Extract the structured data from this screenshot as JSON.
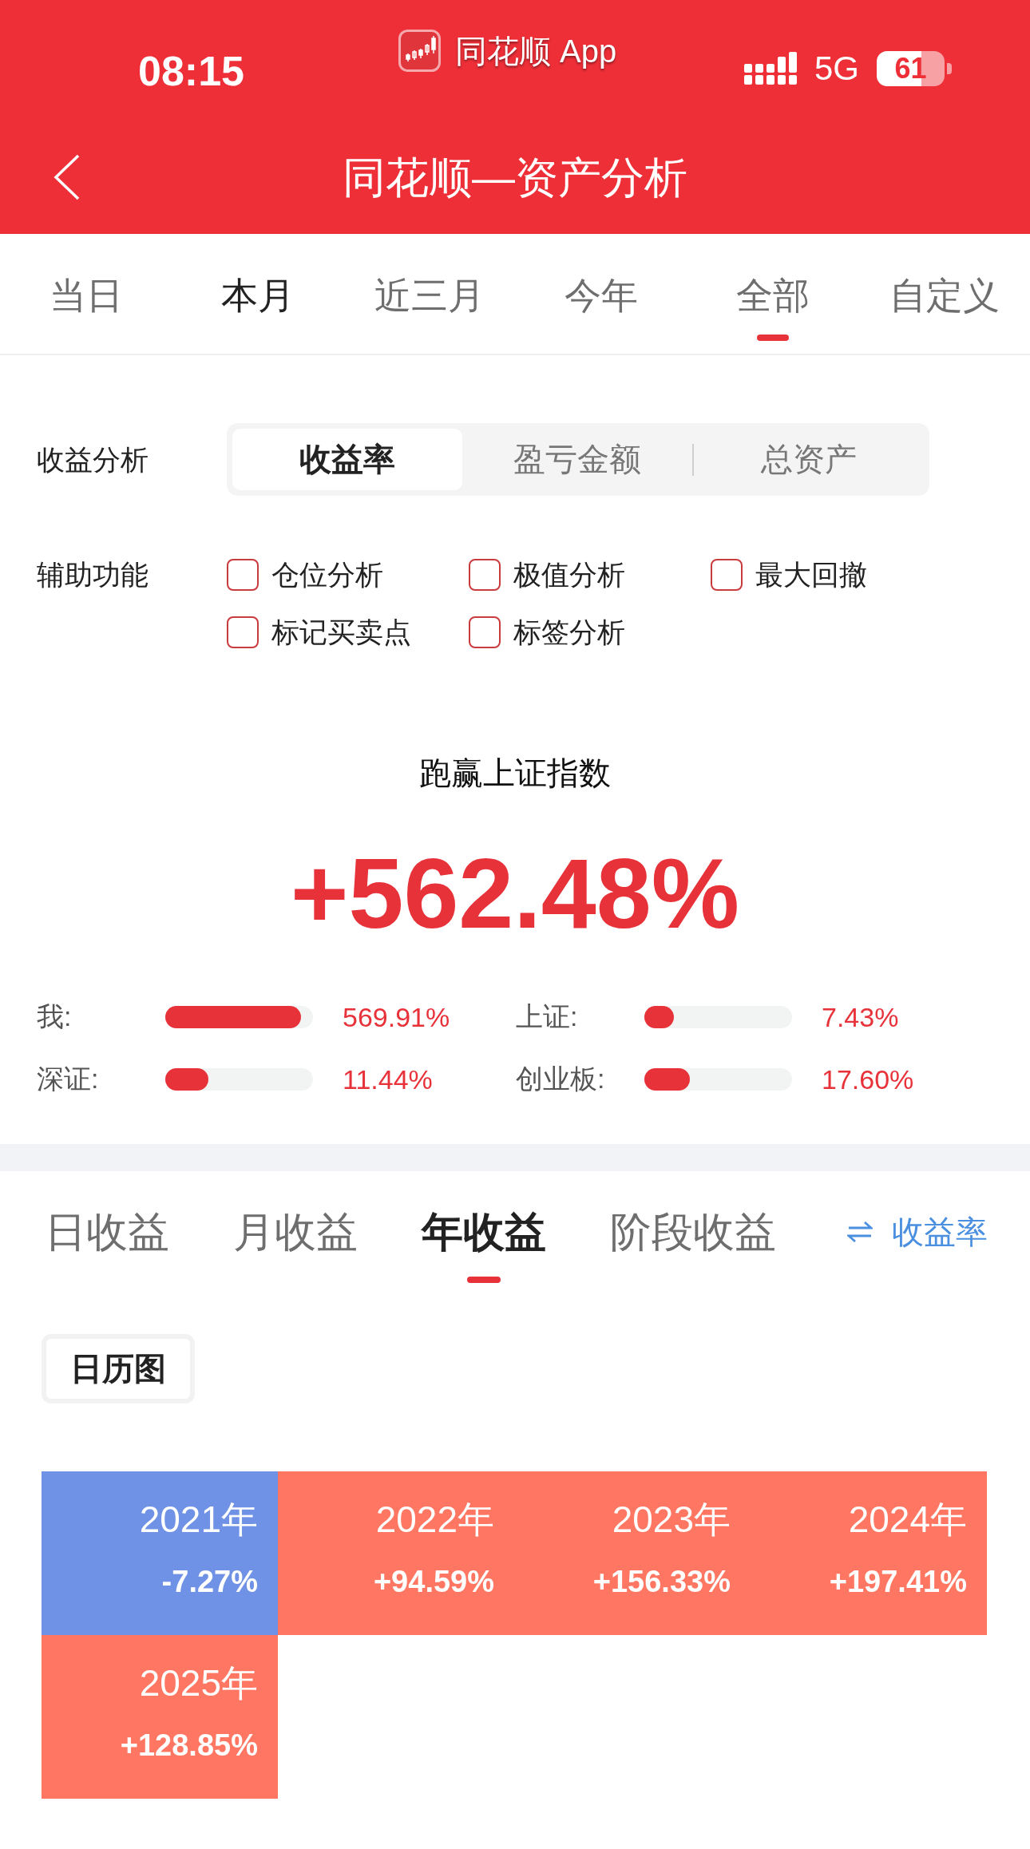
{
  "status_bar": {
    "time": "08:15",
    "app_name": "同花顺 App",
    "network": "5G",
    "battery": "61"
  },
  "header": {
    "title": "同花顺—资产分析"
  },
  "period_tabs": [
    {
      "label": "当日",
      "selected": false,
      "highlighted": false
    },
    {
      "label": "本月",
      "selected": false,
      "highlighted": true
    },
    {
      "label": "近三月",
      "selected": false,
      "highlighted": false
    },
    {
      "label": "今年",
      "selected": false,
      "highlighted": false
    },
    {
      "label": "全部",
      "selected": true,
      "highlighted": false
    },
    {
      "label": "自定义",
      "selected": false,
      "highlighted": false
    }
  ],
  "return_analysis": {
    "label": "收益分析",
    "segments": [
      {
        "label": "收益率",
        "selected": true
      },
      {
        "label": "盈亏金额",
        "selected": false
      },
      {
        "label": "总资产",
        "selected": false
      }
    ]
  },
  "auxiliary": {
    "label": "辅助功能",
    "options": [
      {
        "label": "仓位分析",
        "checked": false
      },
      {
        "label": "极值分析",
        "checked": false
      },
      {
        "label": "最大回撤",
        "checked": false
      },
      {
        "label": "标记买卖点",
        "checked": false
      },
      {
        "label": "标签分析",
        "checked": false
      }
    ]
  },
  "benchmark": {
    "title": "跑赢上证指数",
    "value": "+562.48%",
    "bars": [
      {
        "label": "我:",
        "level": 0.92,
        "reading": "569.91%"
      },
      {
        "label": "上证:",
        "level": 0.2,
        "reading": "7.43%"
      },
      {
        "label": "深证:",
        "level": 0.29,
        "reading": "11.44%"
      },
      {
        "label": "创业板:",
        "level": 0.31,
        "reading": "17.60%"
      }
    ]
  },
  "return_tabs": {
    "tabs": [
      {
        "label": "日收益",
        "selected": false
      },
      {
        "label": "月收益",
        "selected": false
      },
      {
        "label": "年收益",
        "selected": true
      },
      {
        "label": "阶段收益",
        "selected": false
      }
    ],
    "toggle": "收益率"
  },
  "view_button": {
    "label": "日历图"
  },
  "calendar": {
    "cells": [
      {
        "year": "2021年",
        "return": "-7.27%",
        "color": "#6f92e6"
      },
      {
        "year": "2022年",
        "return": "+94.59%",
        "color": "#ff7662"
      },
      {
        "year": "2023年",
        "return": "+156.33%",
        "color": "#ff7662"
      },
      {
        "year": "2024年",
        "return": "+197.41%",
        "color": "#ff7662"
      },
      {
        "year": "2025年",
        "return": "+128.85%",
        "color": "#ff7662"
      }
    ]
  }
}
